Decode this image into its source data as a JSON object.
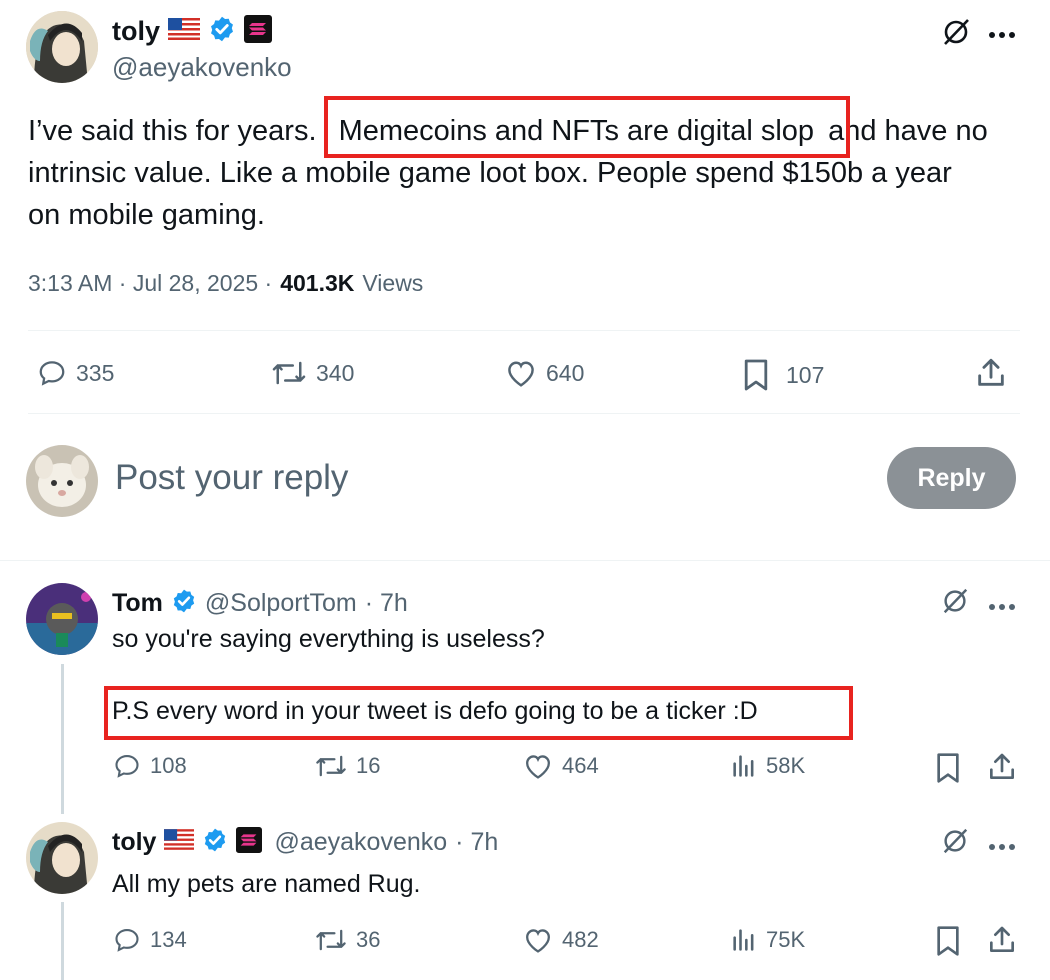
{
  "main_post": {
    "name": "toly",
    "handle": "@aeyakovenko",
    "text_before": "I’ve said this for years.",
    "text_highlight": "Memecoins and NFTs are digital slop",
    "text_after_line1": "and have no",
    "text_line2": "intrinsic value.  Like a mobile game loot box.  People spend $150b a year",
    "text_line3": "on mobile gaming.",
    "time": "3:13 AM · Jul 28, 2025 ·",
    "views_count": "401.3K",
    "views_label": "Views",
    "replies": "335",
    "reposts": "340",
    "likes": "640",
    "bookmarks": "107"
  },
  "reply_box": {
    "placeholder": "Post your reply",
    "button_label": "Reply"
  },
  "replies": [
    {
      "name": "Tom",
      "handle": "@SolportTom",
      "time": "· 7h",
      "text_line1": "so you're saying everything is useless?",
      "text_line2": "P.S every word in your tweet is defo going to be a ticker :D",
      "replies": "108",
      "reposts": "16",
      "likes": "464",
      "views": "58K"
    },
    {
      "name": "toly",
      "handle": "@aeyakovenko",
      "time": "· 7h",
      "text_line1": "All my pets are named Rug.",
      "replies": "134",
      "reposts": "36",
      "likes": "482",
      "views": "75K"
    }
  ],
  "colors": {
    "text": "#0f1419",
    "secondary": "#536471",
    "verified": "#1d9bf0",
    "highlight_box": "#e8231f",
    "reply_button": "#8b9196"
  }
}
